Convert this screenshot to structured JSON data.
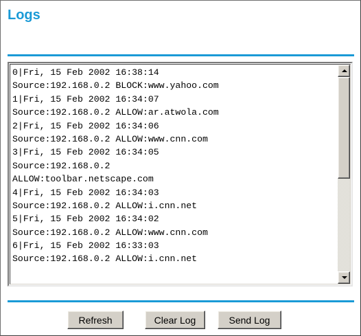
{
  "title": "Logs",
  "log_lines": [
    "0|Fri, 15 Feb 2002 16:38:14",
    "Source:192.168.0.2 BLOCK:www.yahoo.com",
    "1|Fri, 15 Feb 2002 16:34:07",
    "Source:192.168.0.2 ALLOW:ar.atwola.com",
    "2|Fri, 15 Feb 2002 16:34:06",
    "Source:192.168.0.2 ALLOW:www.cnn.com",
    "3|Fri, 15 Feb 2002 16:34:05",
    "Source:192.168.0.2",
    "ALLOW:toolbar.netscape.com",
    "4|Fri, 15 Feb 2002 16:34:03",
    "Source:192.168.0.2 ALLOW:i.cnn.net",
    "5|Fri, 15 Feb 2002 16:34:02",
    "Source:192.168.0.2 ALLOW:www.cnn.com",
    "6|Fri, 15 Feb 2002 16:33:03",
    "Source:192.168.0.2 ALLOW:i.cnn.net"
  ],
  "buttons": {
    "refresh": "Refresh",
    "clear_log": "Clear Log",
    "send_log": "Send Log"
  },
  "colors": {
    "accent": "#1a9ad6"
  },
  "icons": {
    "scroll_up": "arrow-up-icon",
    "scroll_down": "arrow-down-icon"
  }
}
